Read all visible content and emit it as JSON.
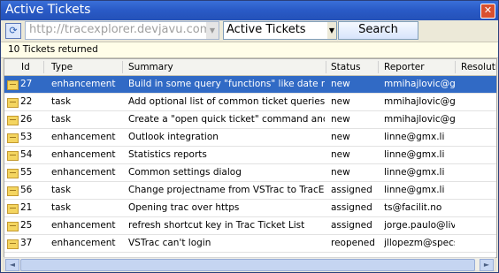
{
  "window": {
    "title": "Active Tickets",
    "close_label": "✕"
  },
  "toolbar": {
    "refresh_label": "⟳",
    "url_value": "http://tracexplorer.devjavu.com/",
    "query_value": "Active Tickets",
    "search_label": "Search"
  },
  "status": {
    "text": "10 Tickets returned"
  },
  "columns": [
    "Id",
    "Type",
    "Summary",
    "Status",
    "Reporter",
    "Resolutio"
  ],
  "rows": [
    {
      "id": "27",
      "type": "enhancement",
      "summary": "Build in some query \"functions\" like date ranges",
      "status": "new",
      "reporter": "mmihajlovic@gm...",
      "resolution": ""
    },
    {
      "id": "22",
      "type": "task",
      "summary": "Add optional list of common ticket queries on add s...",
      "status": "new",
      "reporter": "mmihajlovic@gm...",
      "resolution": ""
    },
    {
      "id": "26",
      "type": "task",
      "summary": "Create a \"open quick ticket\" command and maybe ...",
      "status": "new",
      "reporter": "mmihajlovic@gm...",
      "resolution": ""
    },
    {
      "id": "53",
      "type": "enhancement",
      "summary": "Outlook integration",
      "status": "new",
      "reporter": "linne@gmx.li",
      "resolution": ""
    },
    {
      "id": "54",
      "type": "enhancement",
      "summary": "Statistics reports",
      "status": "new",
      "reporter": "linne@gmx.li",
      "resolution": ""
    },
    {
      "id": "55",
      "type": "enhancement",
      "summary": "Common settings dialog",
      "status": "new",
      "reporter": "linne@gmx.li",
      "resolution": ""
    },
    {
      "id": "56",
      "type": "task",
      "summary": "Change projectname from VSTrac to TracExplorer",
      "status": "assigned",
      "reporter": "linne@gmx.li",
      "resolution": ""
    },
    {
      "id": "21",
      "type": "task",
      "summary": "Opening trac over https",
      "status": "assigned",
      "reporter": "ts@facilit.no",
      "resolution": ""
    },
    {
      "id": "25",
      "type": "enhancement",
      "summary": "refresh shortcut key in Trac Ticket List",
      "status": "assigned",
      "reporter": "jorge.paulo@live...",
      "resolution": ""
    },
    {
      "id": "37",
      "type": "enhancement",
      "summary": "VSTrac can't login",
      "status": "reopened",
      "reporter": "jllopezm@specsa...",
      "resolution": ""
    }
  ],
  "selected_row_index": 0,
  "colors": {
    "titlebar": "#2a5bc7",
    "selection": "#316ac5",
    "status_bg": "#fffde8"
  },
  "icons": {
    "refresh": "refresh-icon",
    "close": "close-icon",
    "ticket": "ticket-icon",
    "dropdown": "chevron-down-icon"
  },
  "scroll": {
    "left_label": "◄",
    "right_label": "►",
    "dropdown_label": "▼"
  }
}
